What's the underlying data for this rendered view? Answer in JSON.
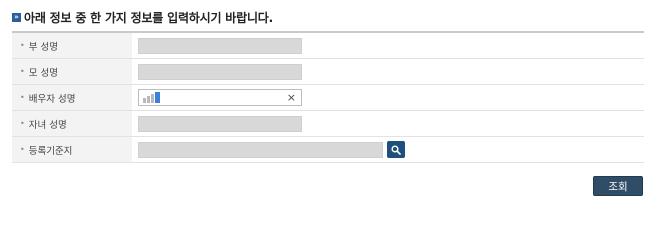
{
  "heading": {
    "marker_glyph": "»",
    "title": "아래 정보 중 한 가지 정보를 입력하시기 바랍니다."
  },
  "form": {
    "rows": [
      {
        "bullet": "•",
        "label": "부 성명"
      },
      {
        "bullet": "•",
        "label": "모 성명"
      },
      {
        "bullet": "•",
        "label": "배우자 성명",
        "clear_icon": "×"
      },
      {
        "bullet": "•",
        "label": "자녀 성명"
      },
      {
        "bullet": "•",
        "label": "등록기준지"
      }
    ]
  },
  "buttons": {
    "submit_label": "조회"
  },
  "icons": {
    "search": "search-icon",
    "clear": "close-icon"
  },
  "colors": {
    "accent": "#2a5d9e",
    "search_button": "#1f4f7c",
    "submit_button": "#2f4d66",
    "active_caret": "#3b82d6"
  }
}
